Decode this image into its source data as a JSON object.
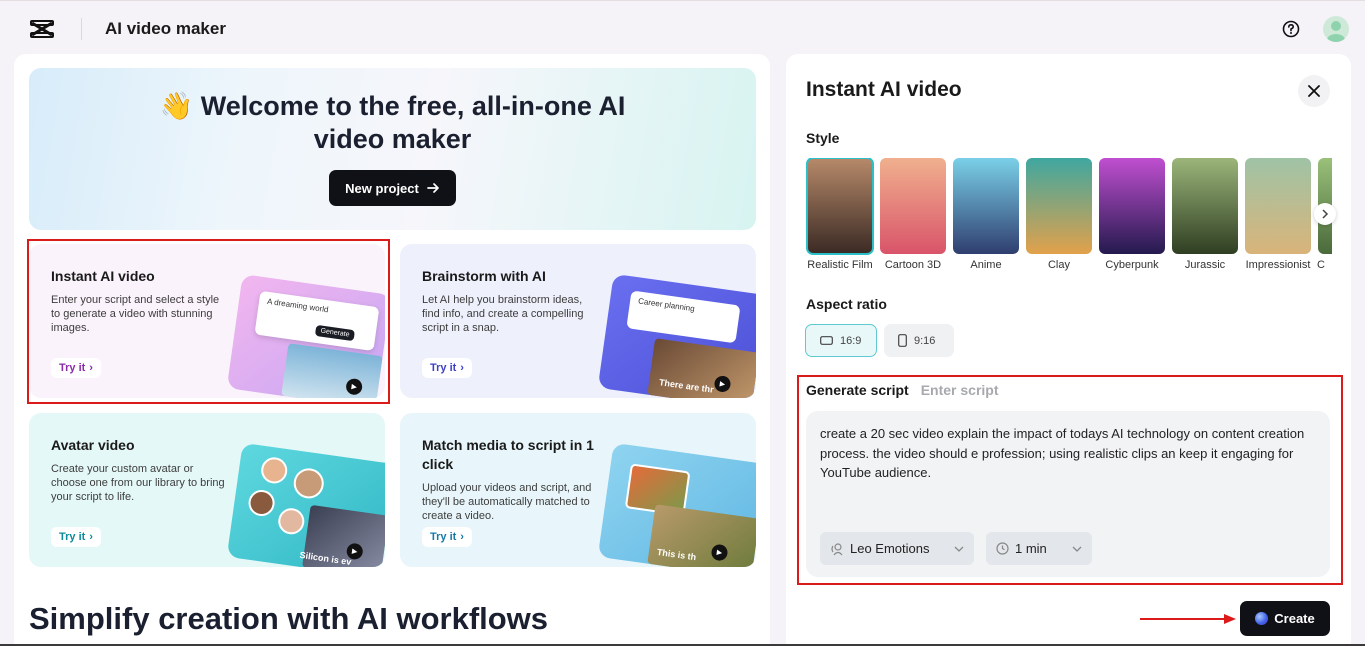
{
  "app": {
    "title": "AI video maker"
  },
  "hero": {
    "title_line1": "👋 Welcome to the free, all-in-one AI",
    "title_line2": "video maker",
    "new_project": "New project"
  },
  "cards": [
    {
      "title": "Instant AI video",
      "desc": "Enter your script and select a style to generate a video with stunning images.",
      "try": "Try it",
      "thumb_text": "A dreaming world",
      "thumb_button": "Generate"
    },
    {
      "title": "Brainstorm with AI",
      "desc": "Let AI help you brainstorm ideas, find info, and create a compelling script in a snap.",
      "try": "Try it",
      "thumb_text": "Career planning",
      "thumb_caption": "There are thr"
    },
    {
      "title": "Avatar video",
      "desc": "Create your custom avatar or choose one from our library to bring your script to life.",
      "try": "Try it",
      "thumb_caption": "Silicon is ev"
    },
    {
      "title": "Match media to script in 1 click",
      "desc": "Upload your videos and script, and they'll be automatically matched to create a video.",
      "try": "Try it",
      "thumb_caption": "This is th"
    }
  ],
  "section": {
    "title": "Simplify creation with AI workflows"
  },
  "panel": {
    "title": "Instant AI video",
    "style_label": "Style",
    "styles": [
      {
        "name": "Realistic Film",
        "selected": true,
        "color": "#6b4a3a"
      },
      {
        "name": "Cartoon 3D",
        "selected": false,
        "color": "#d9546a"
      },
      {
        "name": "Anime",
        "selected": false,
        "color": "#4f9bd0"
      },
      {
        "name": "Clay",
        "selected": false,
        "color": "#e2a14b"
      },
      {
        "name": "Cyberpunk",
        "selected": false,
        "color": "#6a3fb8"
      },
      {
        "name": "Jurassic",
        "selected": false,
        "color": "#5d7a3c"
      },
      {
        "name": "Impressionist",
        "selected": false,
        "color": "#c8a46e"
      },
      {
        "name": "C",
        "selected": false,
        "color": "#7aa36a"
      }
    ],
    "aspect_label": "Aspect ratio",
    "aspects": [
      {
        "label": "16:9",
        "selected": true
      },
      {
        "label": "9:16",
        "selected": false
      }
    ],
    "tab_generate": "Generate script",
    "tab_enter": "Enter script",
    "script_text": "create a 20 sec video explain the impact of todays AI technology on content creation process. the video should e profession; using realistic clips an keep it engaging for YouTube audience.",
    "voice": "Leo Emotions",
    "duration": "1 min",
    "create": "Create"
  }
}
